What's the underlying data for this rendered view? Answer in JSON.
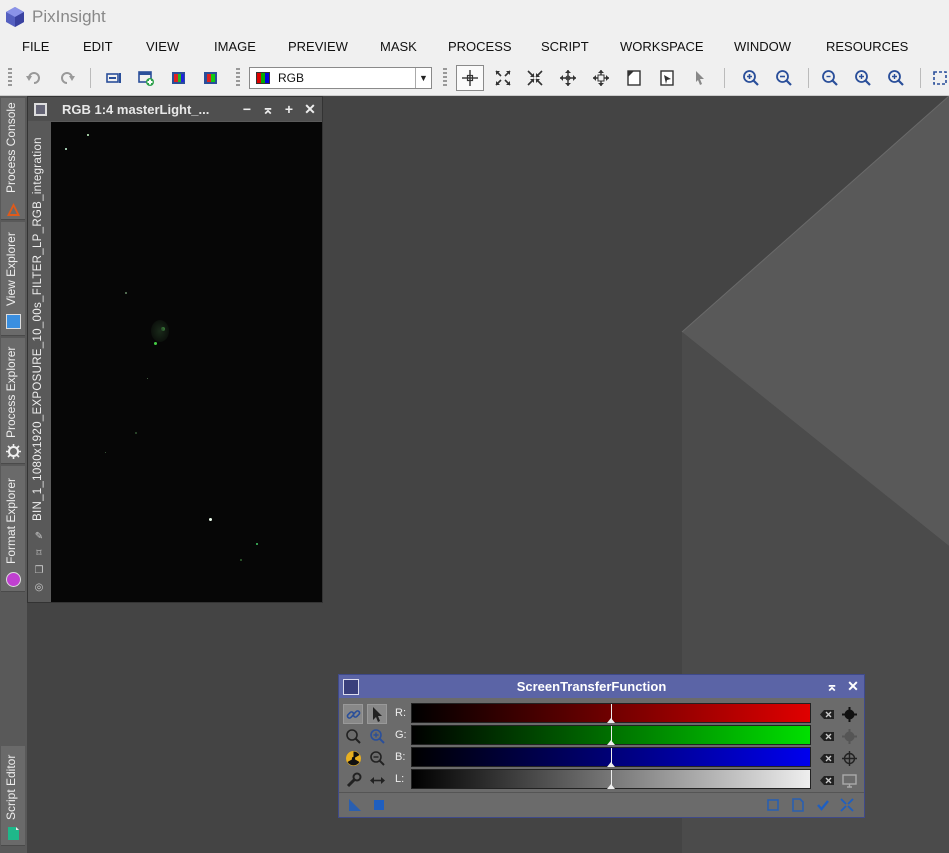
{
  "app": {
    "title": "PixInsight"
  },
  "menu": [
    "FILE",
    "EDIT",
    "VIEW",
    "IMAGE",
    "PREVIEW",
    "MASK",
    "PROCESS",
    "SCRIPT",
    "WORKSPACE",
    "WINDOW",
    "RESOURCES"
  ],
  "toolbar": {
    "display_channel": "RGB",
    "icons": [
      "undo-icon",
      "redo-icon",
      "new-image-icon",
      "new-instance-icon",
      "channel-display-icon",
      "rgb-display-icon",
      "readout-mode-icon",
      "zoom-mode-icon",
      "pan-mode-icon",
      "center-mode-icon",
      "move-mode-icon",
      "edit-preview-icon",
      "new-preview-icon",
      "select-mode-icon",
      "zoom-in-icon",
      "zoom-out-icon",
      "zoom-fit-icon",
      "zoom-in-2-icon",
      "zoom-out-2-icon"
    ]
  },
  "side_dock": {
    "tabs": [
      "Process Console",
      "View Explorer",
      "Process Explorer",
      "Format Explorer",
      "Script Editor"
    ]
  },
  "image_window": {
    "title": "RGB 1:4 masterLight_...",
    "side_label": "BIN_1_1080x1920_EXPOSURE_10_00s_FILTER_LP_RGB_integration"
  },
  "stf": {
    "title": "ScreenTransferFunction",
    "channels": [
      {
        "label": "R:",
        "color": "#e00000",
        "midtone": 0.5
      },
      {
        "label": "G:",
        "color": "#00e000",
        "midtone": 0.5
      },
      {
        "label": "B:",
        "color": "#0000ee",
        "midtone": 0.5
      },
      {
        "label": "L:",
        "color": "#eeeeee",
        "midtone": 0.5
      }
    ]
  },
  "colors": {
    "stf_titlebar": "#5b64a6",
    "workspace": "#444444"
  }
}
